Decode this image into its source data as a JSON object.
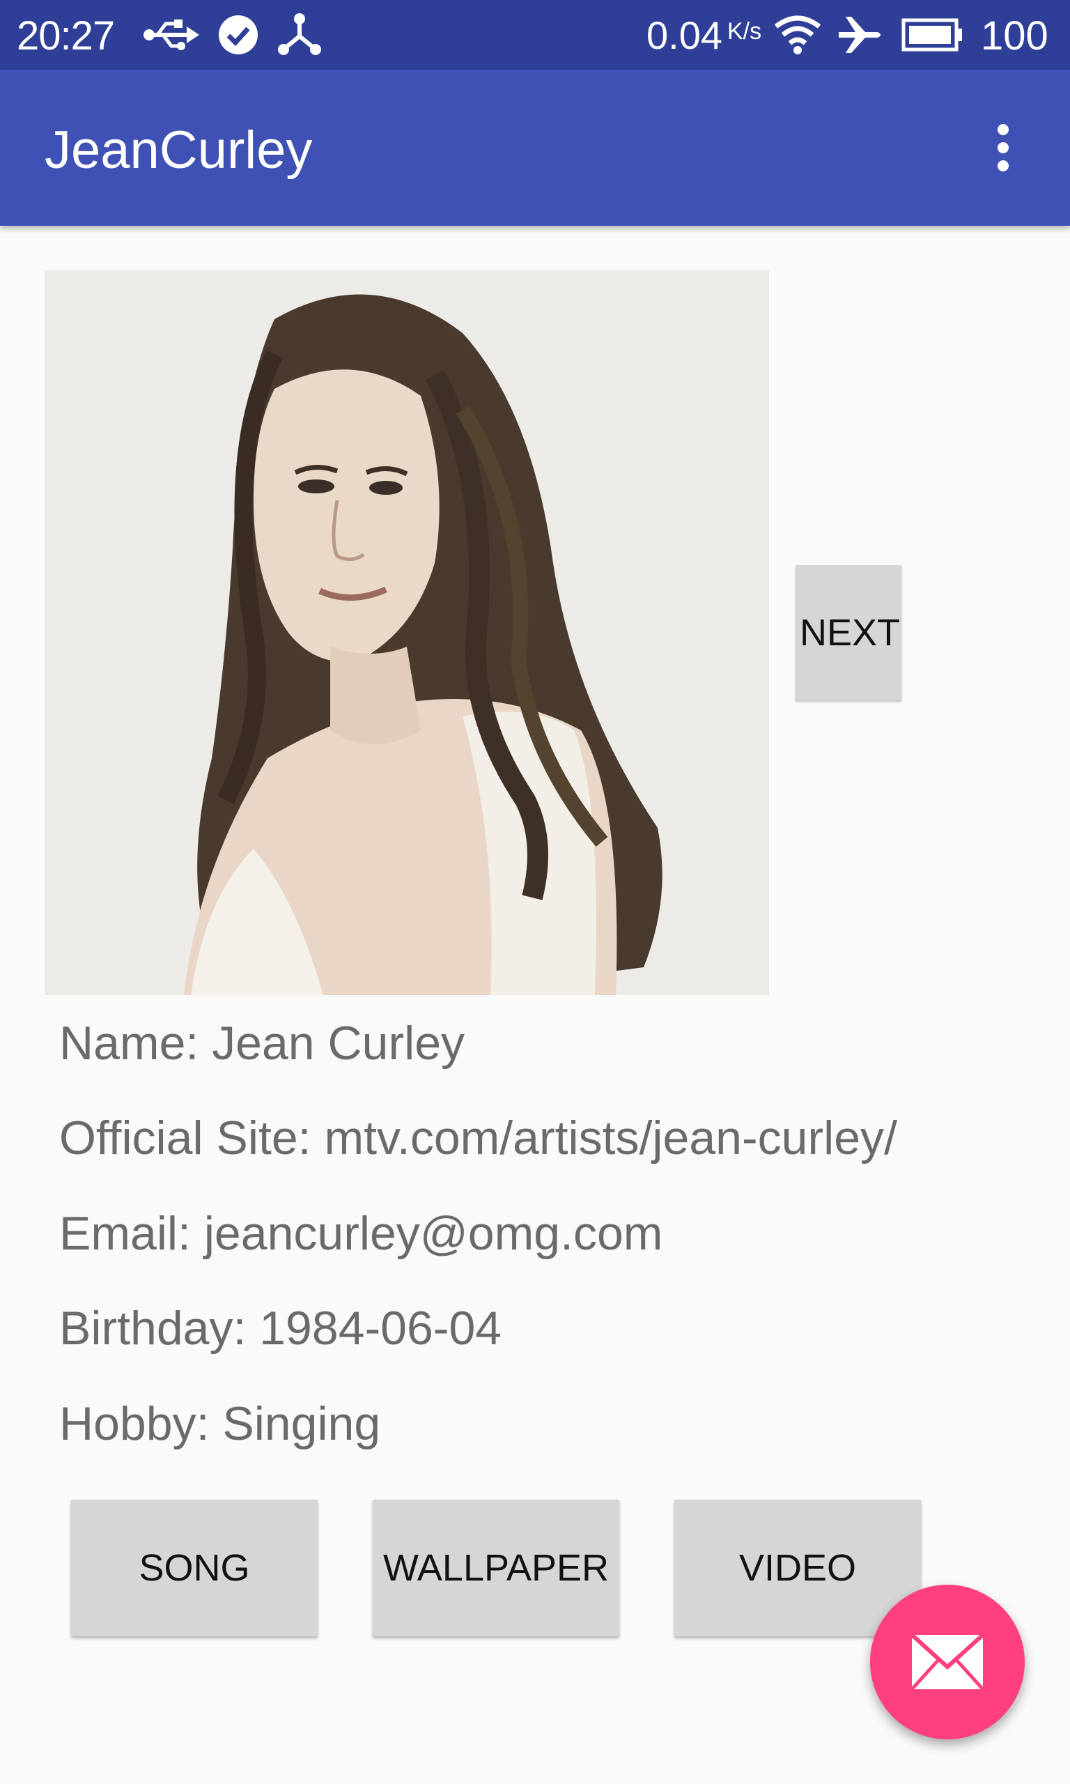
{
  "status_bar": {
    "time": "20:27",
    "network_speed": "0.04",
    "network_speed_unit": "K/s",
    "battery_level": "100",
    "icons": [
      "usb-icon",
      "check-circle-icon",
      "share-icon",
      "wifi-icon",
      "airplane-icon",
      "battery-icon"
    ]
  },
  "app_bar": {
    "title": "JeanCurley",
    "menu_icon": "more-vert-icon"
  },
  "profile": {
    "photo_label": "Jean Curley portrait",
    "next_label": "NEXT",
    "name": "Name: Jean Curley",
    "official_site": "Official Site: mtv.com/artists/jean-curley/",
    "email": "Email: jeancurley@omg.com",
    "birthday": "Birthday: 1984-06-04",
    "hobby": "Hobby: Singing"
  },
  "actions": {
    "song_label": "SONG",
    "wallpaper_label": "WALLPAPER",
    "video_label": "VIDEO"
  },
  "fab": {
    "icon": "email-icon"
  },
  "colors": {
    "status_bar": "#2f3f98",
    "app_bar": "#3f51b5",
    "fab": "#ff3f80",
    "button": "#d6d6d6",
    "background": "#fafafa"
  }
}
